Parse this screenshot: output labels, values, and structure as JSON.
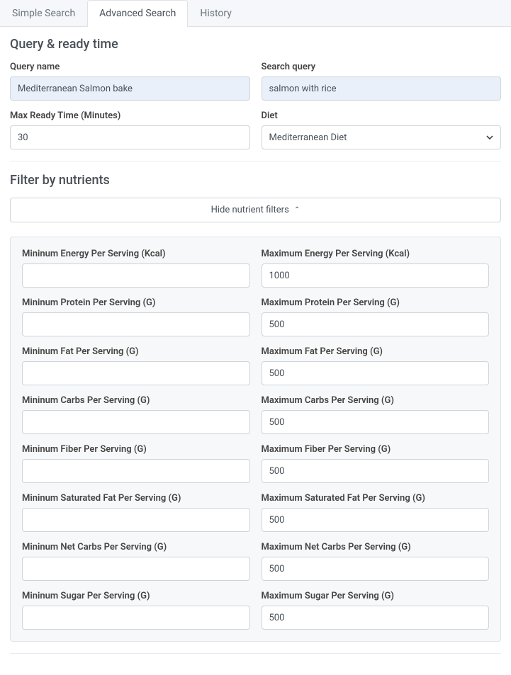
{
  "tabs": {
    "simple": "Simple Search",
    "advanced": "Advanced Search",
    "history": "History"
  },
  "section1_title": "Query & ready time",
  "section2_title": "Filter by nutrients",
  "toggle_label": "Hide nutrient filters",
  "query": {
    "name_label": "Query name",
    "name_value": "Mediterranean Salmon bake",
    "search_label": "Search query",
    "search_value": "salmon with rice",
    "ready_label": "Max Ready Time (Minutes)",
    "ready_value": "30",
    "diet_label": "Diet",
    "diet_value": "Mediterranean Diet"
  },
  "nutrients": [
    {
      "min_label": "Mininum Energy Per Serving (Kcal)",
      "min_value": "",
      "max_label": "Maximum Energy Per Serving (Kcal)",
      "max_value": "1000"
    },
    {
      "min_label": "Mininum Protein Per Serving (G)",
      "min_value": "",
      "max_label": "Maximum Protein Per Serving (G)",
      "max_value": "500"
    },
    {
      "min_label": "Mininum Fat Per Serving (G)",
      "min_value": "",
      "max_label": "Maximum Fat Per Serving (G)",
      "max_value": "500"
    },
    {
      "min_label": "Mininum Carbs Per Serving (G)",
      "min_value": "",
      "max_label": "Maximum Carbs Per Serving (G)",
      "max_value": "500"
    },
    {
      "min_label": "Mininum Fiber Per Serving (G)",
      "min_value": "",
      "max_label": "Maximum Fiber Per Serving (G)",
      "max_value": "500"
    },
    {
      "min_label": "Mininum Saturated Fat Per Serving (G)",
      "min_value": "",
      "max_label": "Maximum Saturated Fat Per Serving (G)",
      "max_value": "500"
    },
    {
      "min_label": "Mininum Net Carbs Per Serving (G)",
      "min_value": "",
      "max_label": "Maximum Net Carbs Per Serving (G)",
      "max_value": "500"
    },
    {
      "min_label": "Mininum Sugar Per Serving (G)",
      "min_value": "",
      "max_label": "Maximum Sugar Per Serving (G)",
      "max_value": "500"
    }
  ]
}
